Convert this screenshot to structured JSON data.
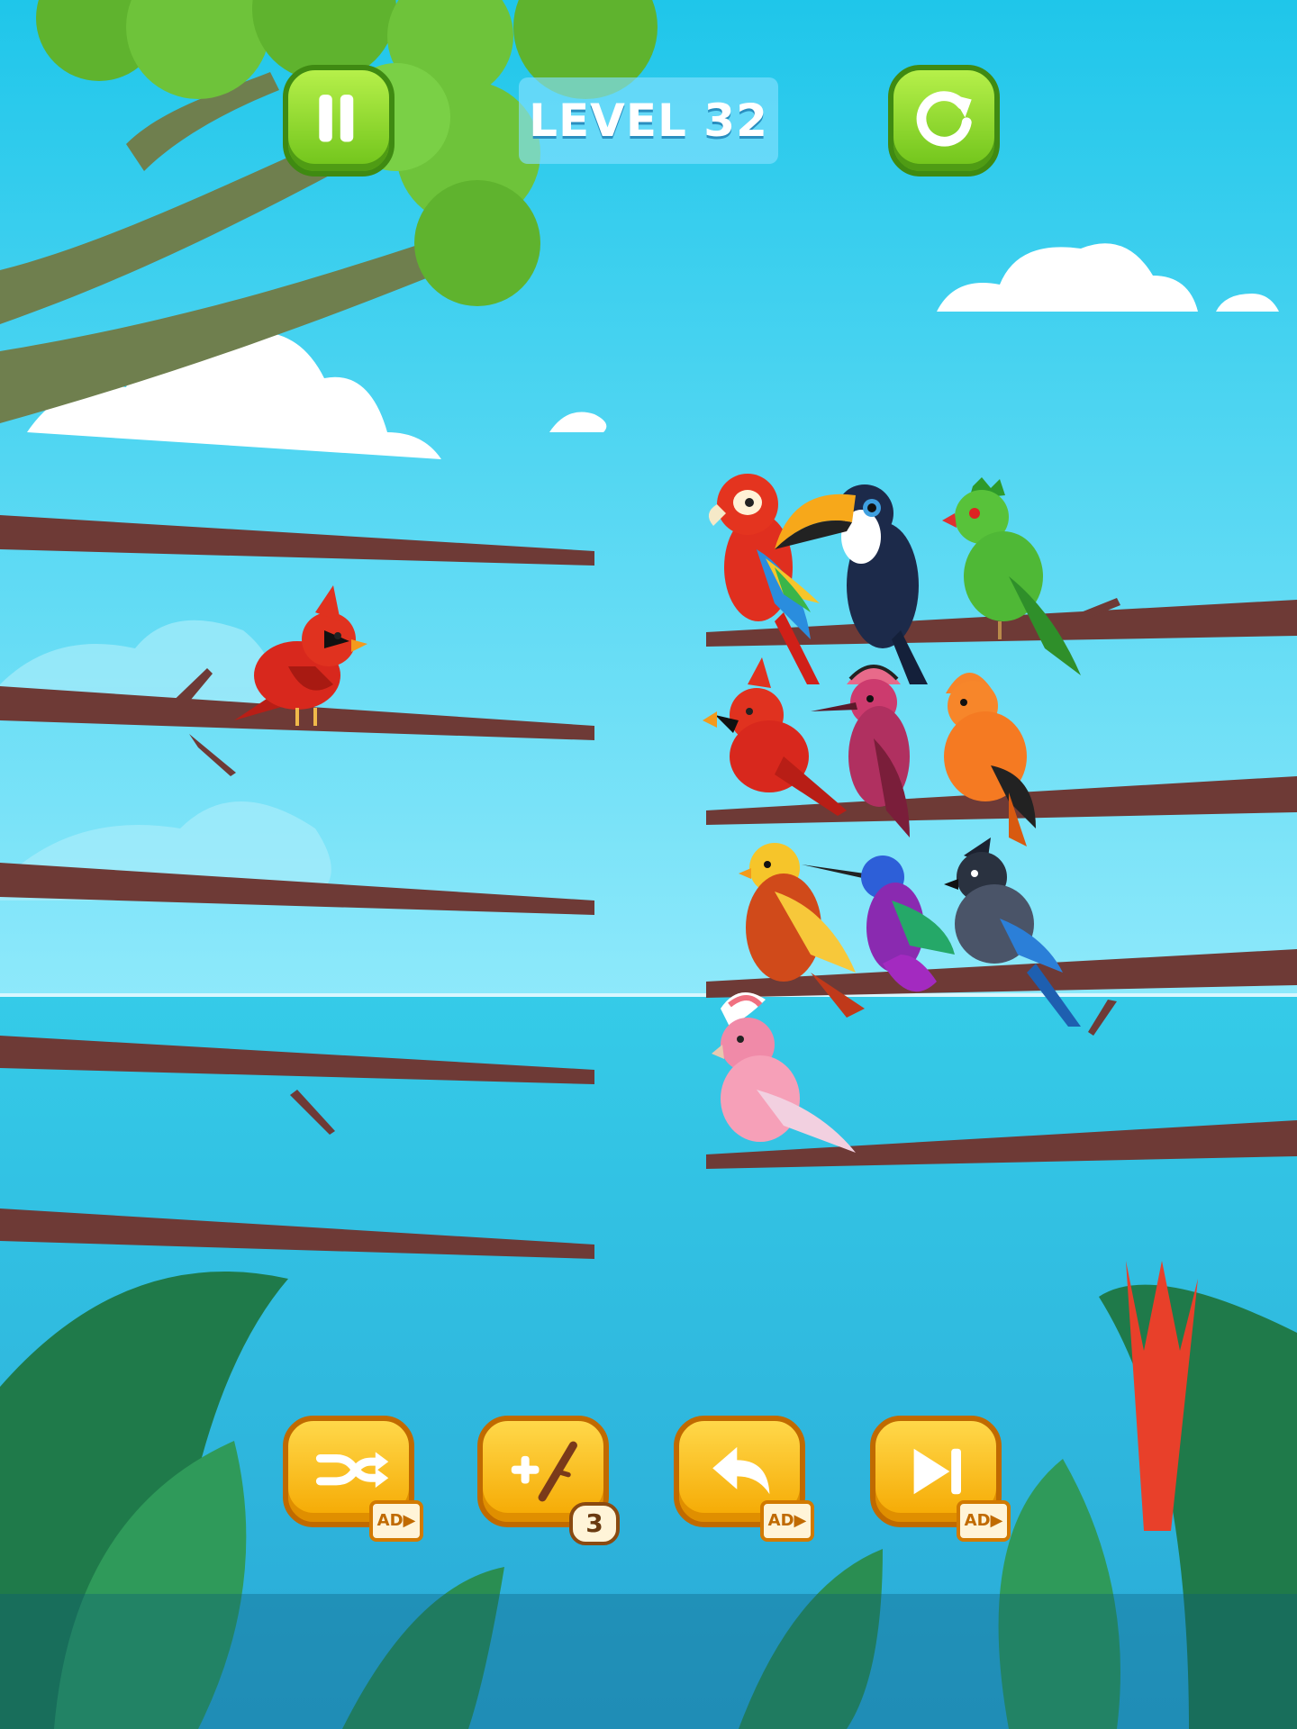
{
  "hud": {
    "level_label": "LEVEL 32",
    "pause_icon": "pause-icon",
    "restart_icon": "restart-icon"
  },
  "branches": {
    "left": [
      {
        "birds": []
      },
      {
        "birds": [
          "cardinal"
        ]
      },
      {
        "birds": []
      },
      {
        "birds": []
      },
      {
        "birds": []
      }
    ],
    "right": [
      {
        "birds": [
          "macaw",
          "toucan",
          "green-turaco"
        ]
      },
      {
        "birds": [
          "cardinal",
          "hoopoe",
          "orange-cock-of-the-rock"
        ]
      },
      {
        "birds": [
          "golden-pheasant",
          "hummingbird",
          "blue-jay"
        ]
      },
      {
        "birds": [
          "galah-cockatoo"
        ]
      }
    ]
  },
  "tools": {
    "shuffle": {
      "icon": "shuffle-icon",
      "badge": "AD▶"
    },
    "add_branch": {
      "icon": "add-branch-icon",
      "badge": "3"
    },
    "undo": {
      "icon": "undo-icon",
      "badge": "AD▶"
    },
    "skip": {
      "icon": "skip-icon",
      "badge": "AD▶"
    }
  },
  "colors": {
    "sky_top": "#1fc6ea",
    "sky_bottom": "#8ee9fb",
    "sea": "#27c3e6",
    "branch": "#6e3a36",
    "green_button": "#7fd424",
    "orange_button": "#ffc21a"
  }
}
